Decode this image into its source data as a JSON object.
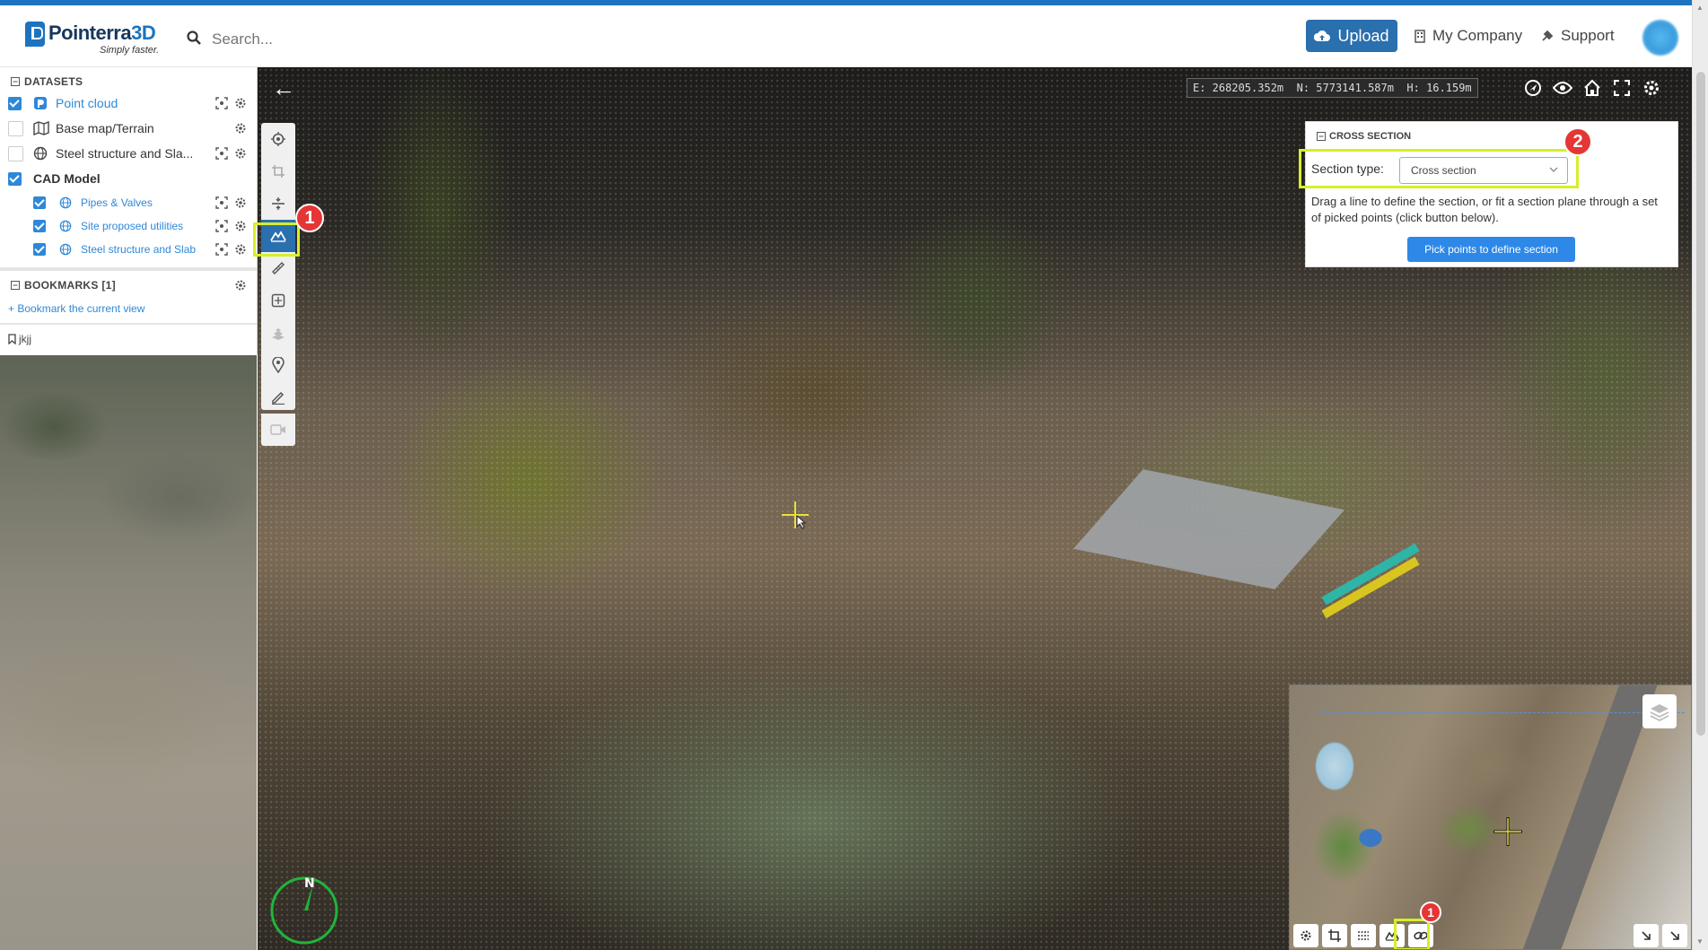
{
  "app": {
    "brand": "Pointerra3D",
    "brand_part1": "Pointerra",
    "brand_part2": "3D",
    "tagline": "Simply faster.",
    "accent_color": "#1e73be"
  },
  "header": {
    "search_placeholder": "Search...",
    "upload_label": "Upload",
    "company_label": "My Company",
    "support_label": "Support"
  },
  "datasets": {
    "title": "DATASETS",
    "items": [
      {
        "label": "Point cloud",
        "checked": true
      },
      {
        "label": "Base map/Terrain",
        "checked": false
      },
      {
        "label": "Steel structure and Sla...",
        "checked": false
      }
    ],
    "cad": {
      "label": "CAD Model",
      "checked": true,
      "children": [
        {
          "label": "Pipes & Valves",
          "checked": true
        },
        {
          "label": "Site proposed utilities",
          "checked": true
        },
        {
          "label": "Steel structure and Slab",
          "checked": true
        }
      ]
    }
  },
  "bookmarks": {
    "title": "BOOKMARKS [1]",
    "add_label": "Bookmark the current view",
    "items": [
      "jkjj"
    ]
  },
  "viewer": {
    "coordinates": "E: 268205.352m  N: 5773141.587m  H: 16.159m",
    "compass_label": "N"
  },
  "tools": [
    "target-icon",
    "crop-icon",
    "slice-icon",
    "cross-section-icon",
    "ruler-icon",
    "volume-icon",
    "stack-icon",
    "pin-icon",
    "markup-icon",
    "video-icon"
  ],
  "annotations": {
    "badge1": "1",
    "badge2": "2",
    "minimap_badge": "1",
    "highlight_color": "#d7ee2a"
  },
  "cross_section": {
    "title": "CROSS SECTION",
    "section_type_label": "Section type:",
    "section_type_value": "Cross section",
    "description": "Drag a line to define the section, or fit a section plane through a set of picked points (click button below).",
    "button_label": "Pick points to define section"
  }
}
